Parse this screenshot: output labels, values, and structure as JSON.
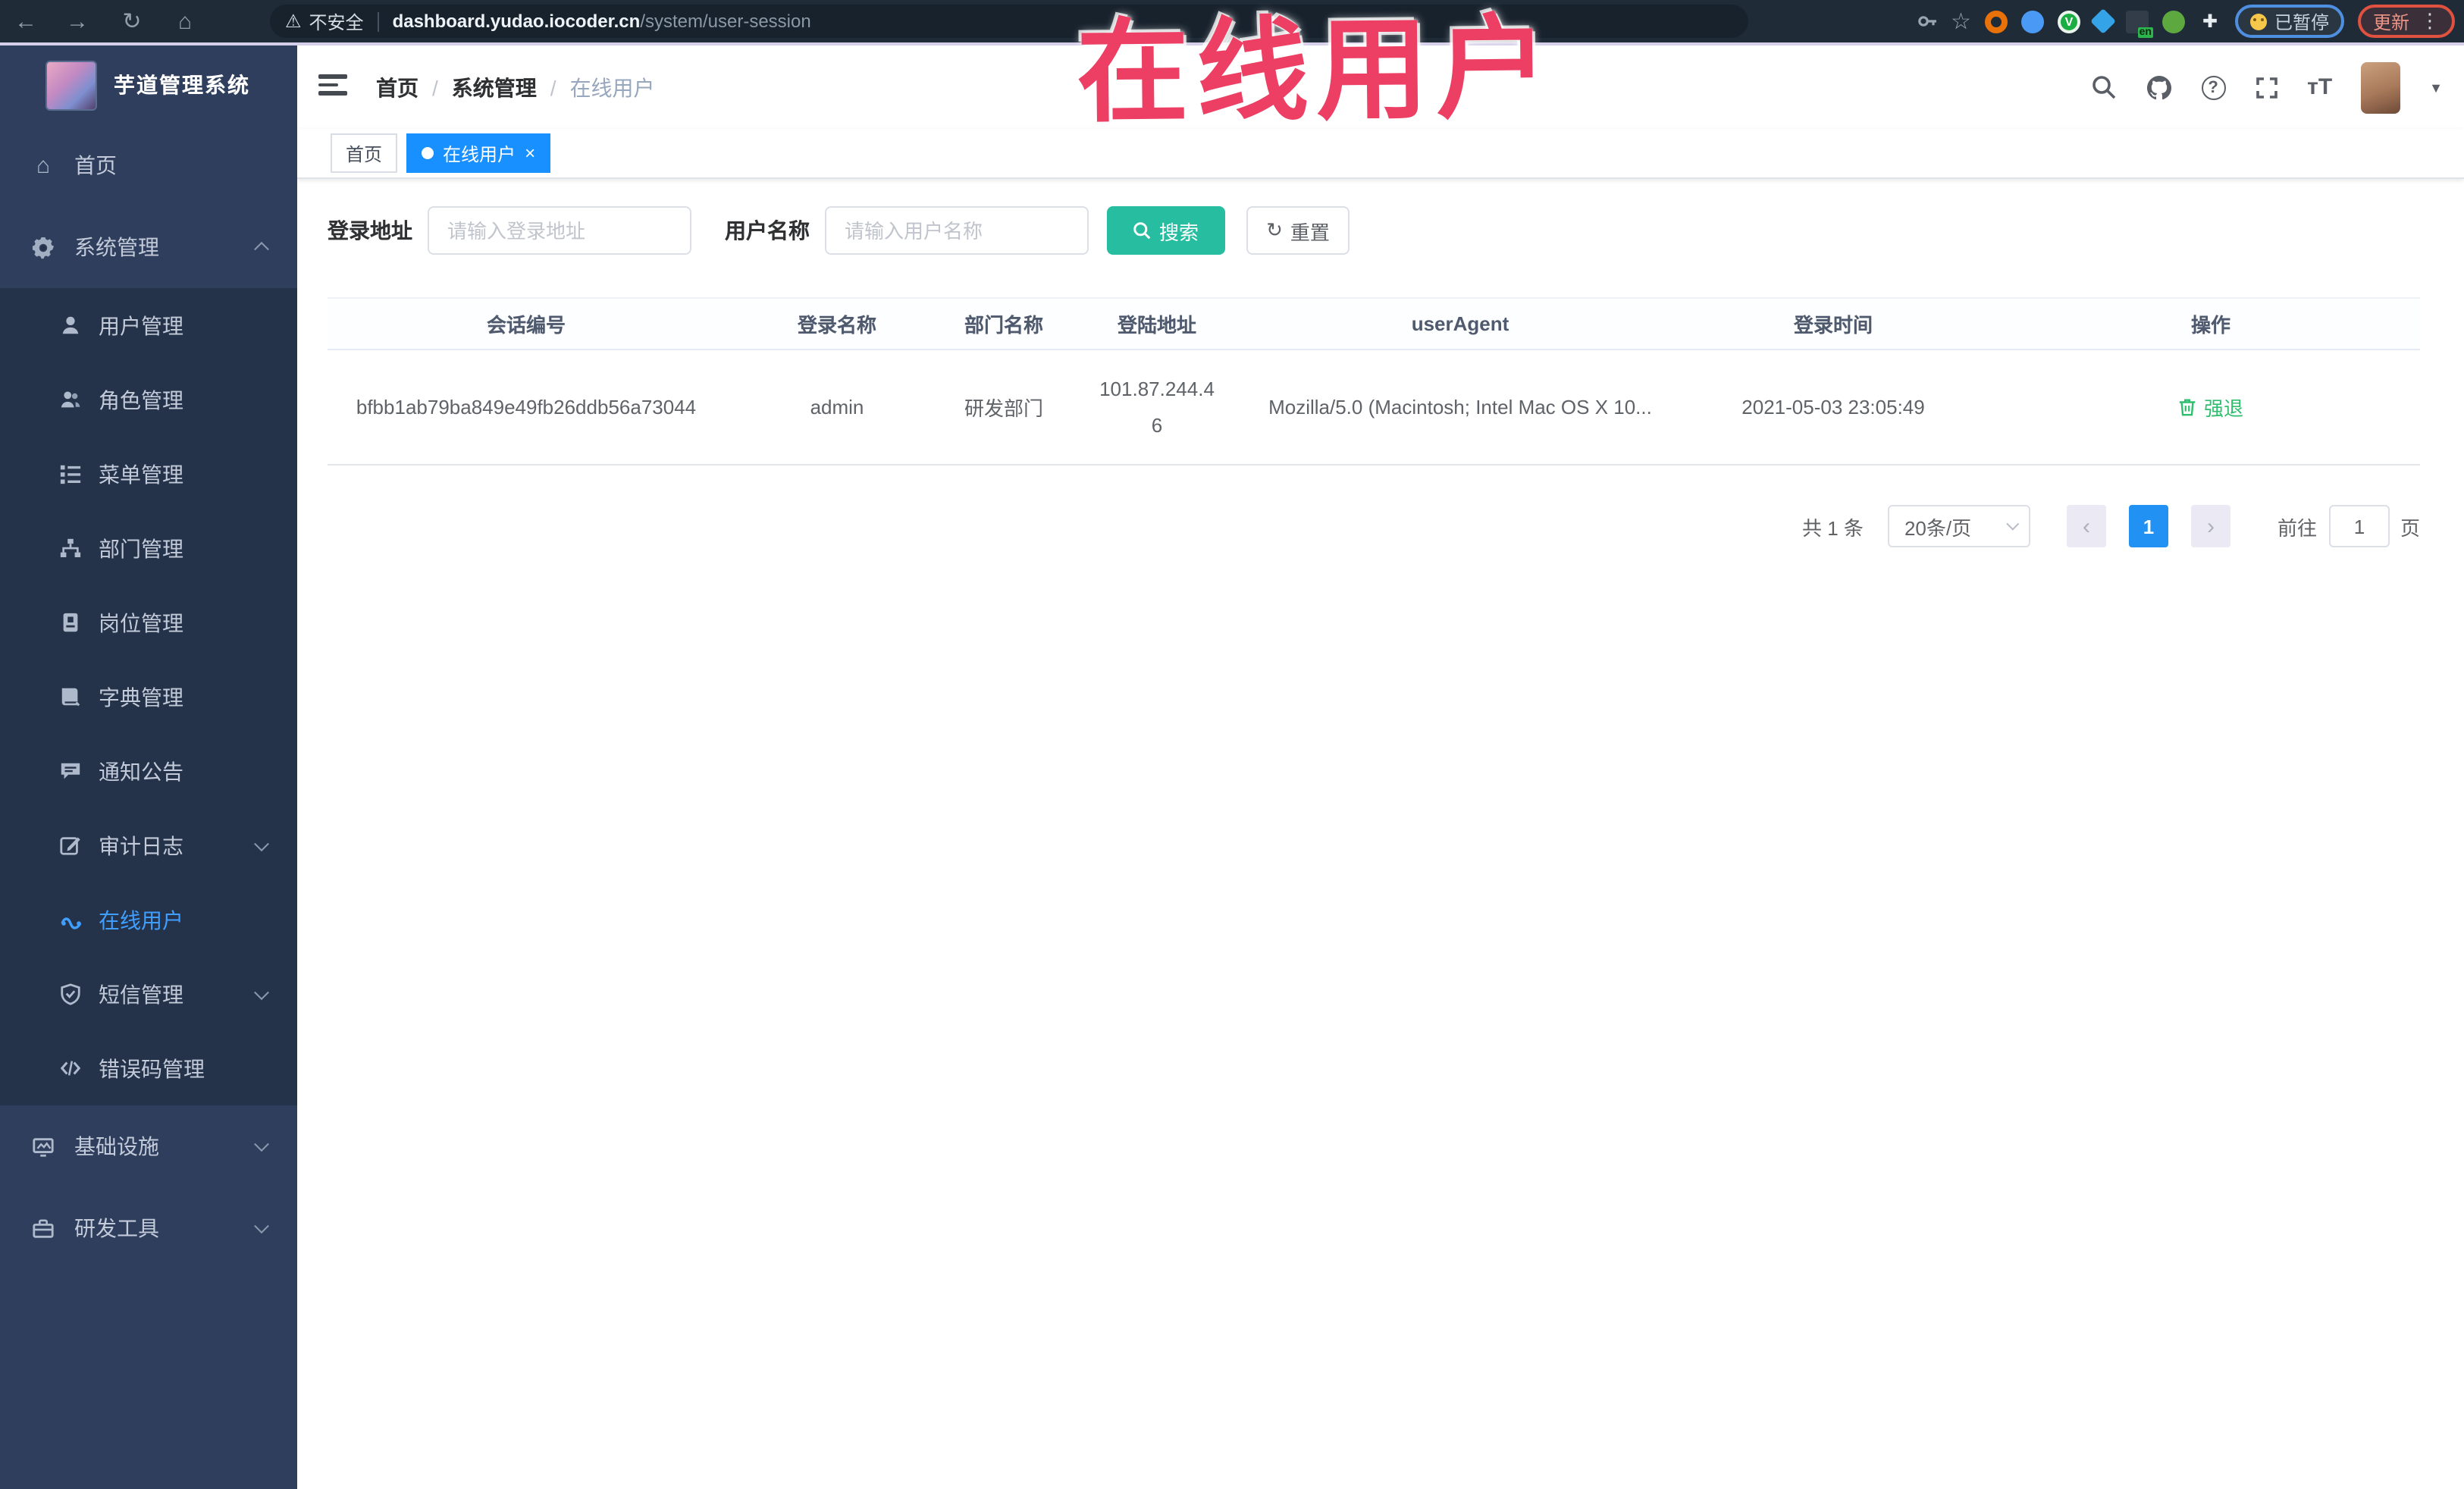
{
  "colors": {
    "accent_blue": "#1890ff",
    "element_blue": "#409eff",
    "teal_button": "#27bda1",
    "action_green": "#2fbe6e",
    "annotation_red": "#ed3f63",
    "sidebar_bg": "#2f3e5c",
    "submenu_bg": "#24334a",
    "browser_bg": "#202b38"
  },
  "icons": {
    "back": "←",
    "forward": "→",
    "reload": "↻",
    "home": "⌂",
    "warning": "⚠",
    "star": "☆",
    "puzzle": "✚",
    "dots": "⋮",
    "slash": "/",
    "dot": "●",
    "close": "×",
    "caret_down": "▼",
    "prev": "‹",
    "next": "›",
    "question": "?",
    "font_size": "тT",
    "refresh": "↻"
  },
  "browser": {
    "security_label": "不安全",
    "url_host": "dashboard.yudao.iocoder.cn",
    "url_path": "/system/user-session",
    "ext_v_label": "V",
    "ext_en_badge": "en",
    "paused_label": "已暂停",
    "update_label": "更新"
  },
  "annotation": {
    "text": "在线用户"
  },
  "sidebar": {
    "title": "芋道管理系统",
    "home_label": "首页",
    "system_label": "系统管理",
    "submenu": [
      "用户管理",
      "角色管理",
      "菜单管理",
      "部门管理",
      "岗位管理",
      "字典管理",
      "通知公告",
      "审计日志",
      "在线用户",
      "短信管理",
      "错误码管理"
    ],
    "infra_label": "基础设施",
    "devtools_label": "研发工具"
  },
  "breadcrumb": {
    "items": [
      "首页",
      "系统管理",
      "在线用户"
    ],
    "separator": "/"
  },
  "tabs": [
    {
      "label": "首页"
    },
    {
      "label": "在线用户"
    }
  ],
  "search": {
    "address_label": "登录地址",
    "address_placeholder": "请输入登录地址",
    "name_label": "用户名称",
    "name_placeholder": "请输入用户名称",
    "search_button": "搜索",
    "reset_button": "重置"
  },
  "table": {
    "headers": [
      "会话编号",
      "登录名称",
      "部门名称",
      "登陆地址",
      "userAgent",
      "登录时间",
      "操作"
    ],
    "row": {
      "session_id": "bfbb1ab79ba849e49fb26ddb56a73044",
      "login_name": "admin",
      "dept_name": "研发部门",
      "login_ip": "101.87.244.46",
      "user_agent": "Mozilla/5.0 (Macintosh; Intel Mac OS X 10...",
      "login_time": "2021-05-03 23:05:49",
      "action": "强退"
    }
  },
  "pagination": {
    "total": "共 1 条",
    "page_size": "20条/页",
    "current_page": "1",
    "goto_label": "前往",
    "goto_value": "1",
    "unit": "页"
  }
}
